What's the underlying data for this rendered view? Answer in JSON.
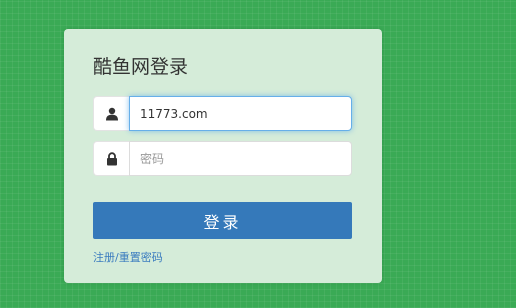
{
  "login": {
    "title": "酷鱼网登录",
    "username": {
      "value": "11773.com",
      "icon": "user-icon"
    },
    "password": {
      "value": "",
      "placeholder": "密码",
      "icon": "lock-icon"
    },
    "submit_label": "登录",
    "register_link": "注册",
    "separator": "/",
    "reset_link": "重置密码"
  },
  "colors": {
    "background": "#3aaa55",
    "panel": "#d5ecd9",
    "button": "#3579ba",
    "link": "#3a7bbf",
    "focus": "#66afe9"
  }
}
